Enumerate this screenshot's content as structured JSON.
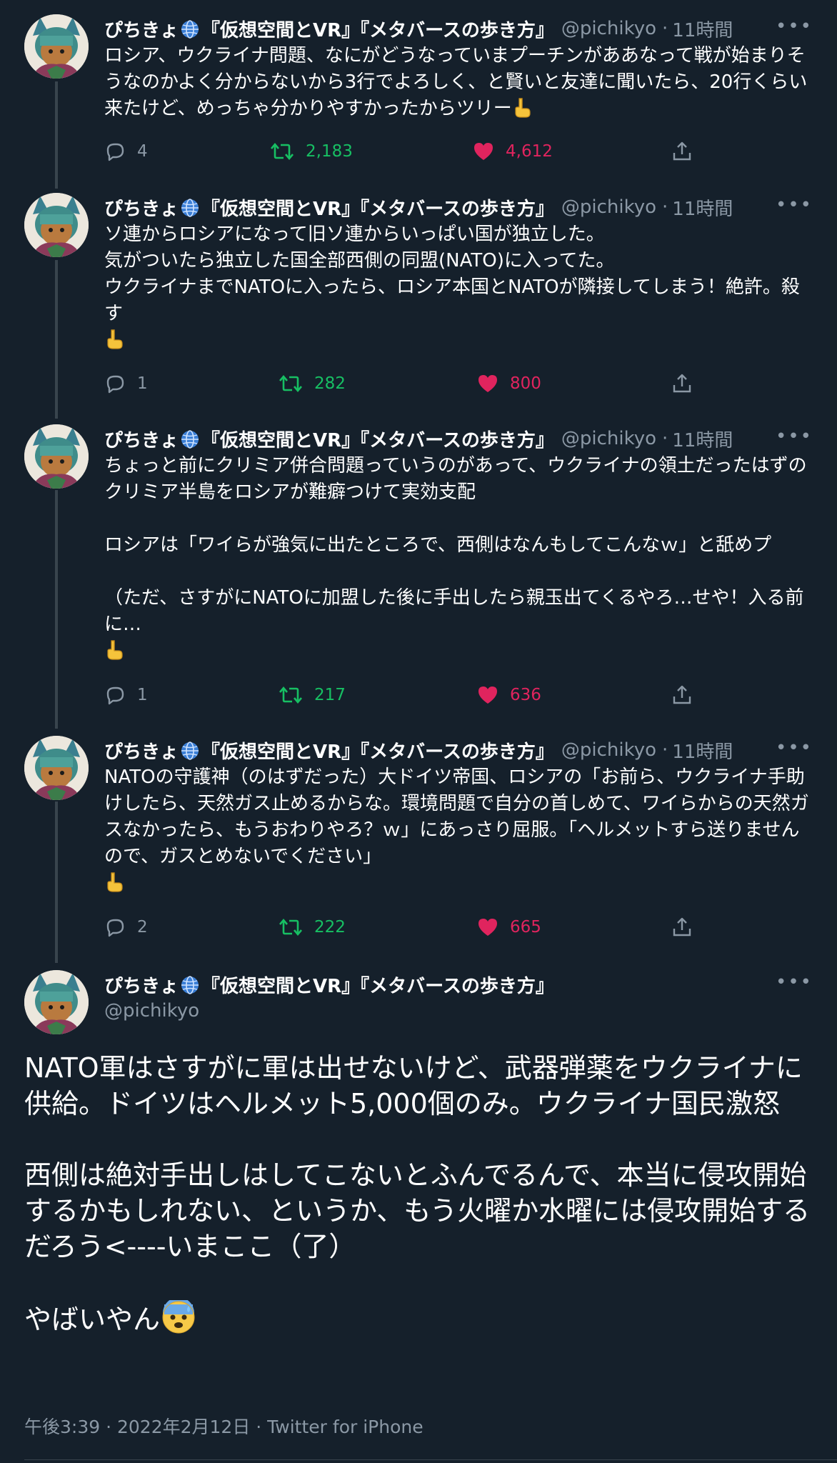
{
  "author": {
    "name_part1": "ぴちきょ",
    "name_part2": "『仮想空間とVR』『メタバースの歩き方』",
    "handle": "@pichikyo"
  },
  "tweets": [
    {
      "time": "11時間",
      "text": "ロシア、ウクライナ問題、なにがどうなっていまプーチンがああなって戦が始まりそうなのかよく分からないから3行でよろしく、と賢いと友達に聞いたら、20行くらい来たけど、めっちゃ分かりやすかったからツリー",
      "replies": "4",
      "retweets": "2,183",
      "likes": "4,612"
    },
    {
      "time": "11時間",
      "text": "ソ連からロシアになって旧ソ連からいっぱい国が独立した。\n気がついたら独立した国全部西側の同盟(NATO)に入ってた。\nウクライナまでNATOに入ったら、ロシア本国とNATOが隣接してしまう！絶許。殺す\n",
      "replies": "1",
      "retweets": "282",
      "likes": "800"
    },
    {
      "time": "11時間",
      "text": "ちょっと前にクリミア併合問題っていうのがあって、ウクライナの領土だったはずのクリミア半島をロシアが難癖つけて実効支配\n\nロシアは「ワイらが強気に出たところで、西側はなんもしてこんなｗ」と舐めプ\n\n（ただ、さすがにNATOに加盟した後に手出したら親玉出てくるやろ…せや！入る前に…\n",
      "replies": "1",
      "retweets": "217",
      "likes": "636"
    },
    {
      "time": "11時間",
      "text": "NATOの守護神（のはずだった）大ドイツ帝国、ロシアの「お前ら、ウクライナ手助けしたら、天然ガス止めるからな。環境問題で自分の首しめて、ワイらからの天然ガスなかったら、もうおわりやろ？ｗ」にあっさり屈服。「ヘルメットすら送りませんので、ガスとめないでください」\n",
      "replies": "2",
      "retweets": "222",
      "likes": "665"
    }
  ],
  "main_tweet": {
    "text": "NATO軍はさすがに軍は出せないけど、武器弾薬をウクライナに供給。ドイツはヘルメット5,000個のみ。ウクライナ国民激怒\n\n西側は絶対手出しはしてこないとふんでるんで、本当に侵攻開始するかもしれない、というか、もう火曜か水曜には侵攻開始するだろう<----いまここ（了）\n\nやばいやん",
    "footer": "午後3:39 · 2022年2月12日 · Twitter for iPhone"
  },
  "separator": "·",
  "icons": {
    "globe": "globe-emoji-icon",
    "pointing_down": "backhand-index-pointing-down-icon",
    "anxious_face": "anxious-face-sweat-icon",
    "reply": "reply-icon",
    "retweet": "retweet-icon",
    "like": "heart-icon",
    "share": "share-icon",
    "more": "more-options-icon"
  },
  "colors": {
    "background": "#15202b",
    "text": "#ffffff",
    "muted": "#8b98a5",
    "retweet": "#17bf63",
    "like": "#e0245e",
    "divider": "#38444d"
  }
}
